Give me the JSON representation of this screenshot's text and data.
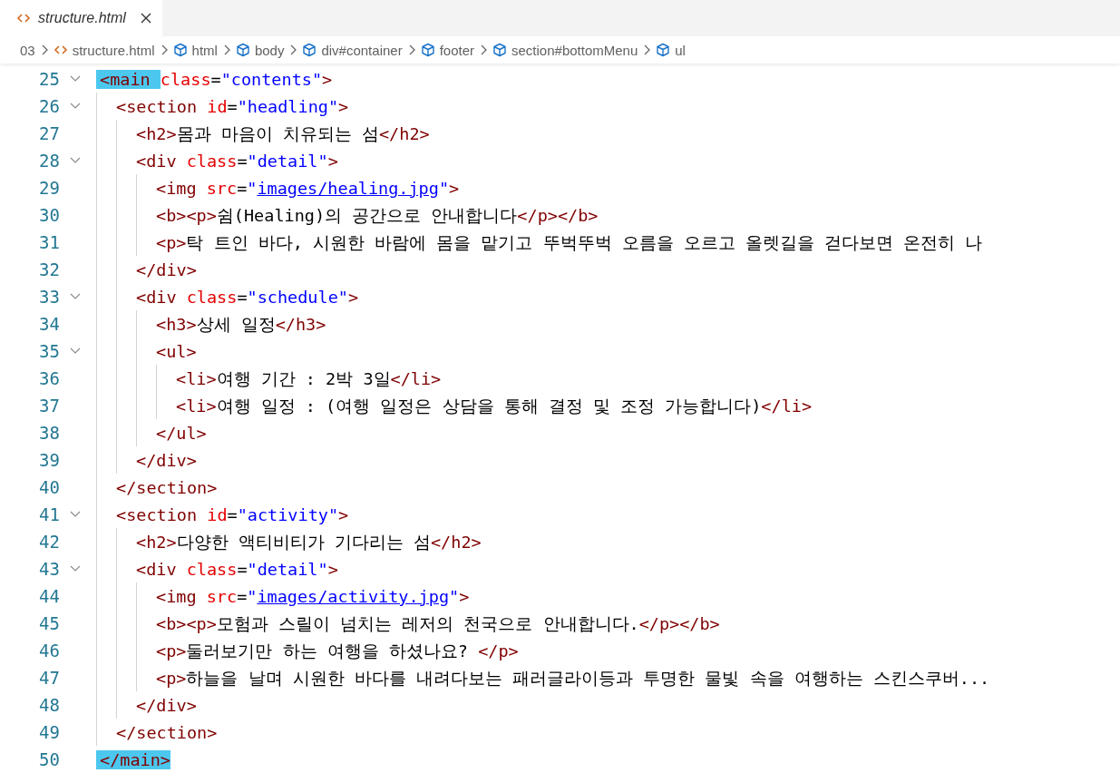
{
  "tab": {
    "title": "structure.html",
    "selected": true
  },
  "breadcrumb": [
    {
      "label": "03",
      "kind": "folder"
    },
    {
      "label": "structure.html",
      "kind": "file"
    },
    {
      "label": "html",
      "kind": "element"
    },
    {
      "label": "body",
      "kind": "element"
    },
    {
      "label": "div#container",
      "kind": "element"
    },
    {
      "label": "footer",
      "kind": "element"
    },
    {
      "label": "section#bottomMenu",
      "kind": "element"
    },
    {
      "label": "ul",
      "kind": "element"
    }
  ],
  "lines": [
    {
      "number": "25",
      "expanded": true,
      "tokens": [
        {
          "kind": "tag-hl",
          "text": "<main "
        },
        {
          "kind": "attr",
          "text": "class"
        },
        {
          "kind": "eq",
          "text": "="
        },
        {
          "kind": "string",
          "text": "\"contents\""
        },
        {
          "kind": "tag",
          "text": ">"
        }
      ],
      "children": [
        {
          "number": "26",
          "expanded": true,
          "tokens": [
            {
              "kind": "tag",
              "text": "<section "
            },
            {
              "kind": "attr",
              "text": "id"
            },
            {
              "kind": "eq",
              "text": "="
            },
            {
              "kind": "string",
              "text": "\"headling\""
            },
            {
              "kind": "tag",
              "text": ">"
            }
          ],
          "children": [
            {
              "number": "27",
              "tokens": [
                {
                  "kind": "tag",
                  "text": "<h2>"
                },
                {
                  "kind": "text",
                  "text": "몸과 마음이 치유되는 섬"
                },
                {
                  "kind": "tag",
                  "text": "</h2>"
                }
              ]
            },
            {
              "number": "28",
              "expanded": true,
              "tokens": [
                {
                  "kind": "tag",
                  "text": "<div "
                },
                {
                  "kind": "attr",
                  "text": "class"
                },
                {
                  "kind": "eq",
                  "text": "="
                },
                {
                  "kind": "string",
                  "text": "\"detail\""
                },
                {
                  "kind": "tag",
                  "text": ">"
                }
              ],
              "children": [
                {
                  "number": "29",
                  "tokens": [
                    {
                      "kind": "tag",
                      "text": "<img "
                    },
                    {
                      "kind": "attr",
                      "text": "src"
                    },
                    {
                      "kind": "eq",
                      "text": "="
                    },
                    {
                      "kind": "string",
                      "text": "\""
                    },
                    {
                      "kind": "link",
                      "text": "images/healing.jpg"
                    },
                    {
                      "kind": "string",
                      "text": "\""
                    },
                    {
                      "kind": "tag",
                      "text": ">"
                    }
                  ]
                },
                {
                  "number": "30",
                  "tokens": [
                    {
                      "kind": "tag",
                      "text": "<b><p>"
                    },
                    {
                      "kind": "text",
                      "text": "쉼(Healing)의 공간으로 안내합니다"
                    },
                    {
                      "kind": "tag",
                      "text": "</p></b>"
                    }
                  ]
                },
                {
                  "number": "31",
                  "tokens": [
                    {
                      "kind": "tag",
                      "text": "<p>"
                    },
                    {
                      "kind": "text",
                      "text": "탁 트인 바다, 시원한 바람에 몸을 맡기고 뚜벅뚜벅 오름을 오르고 올렛길을 걷다보면 온전히 나"
                    }
                  ]
                }
              ]
            },
            {
              "number": "32",
              "tokens": [
                {
                  "kind": "tag",
                  "text": "</div>"
                }
              ]
            },
            {
              "number": "33",
              "expanded": true,
              "tokens": [
                {
                  "kind": "tag",
                  "text": "<div "
                },
                {
                  "kind": "attr",
                  "text": "class"
                },
                {
                  "kind": "eq",
                  "text": "="
                },
                {
                  "kind": "string",
                  "text": "\"schedule\""
                },
                {
                  "kind": "tag",
                  "text": ">"
                }
              ],
              "children": [
                {
                  "number": "34",
                  "tokens": [
                    {
                      "kind": "tag",
                      "text": "<h3>"
                    },
                    {
                      "kind": "text",
                      "text": "상세 일정"
                    },
                    {
                      "kind": "tag",
                      "text": "</h3>"
                    }
                  ]
                },
                {
                  "number": "35",
                  "expanded": true,
                  "tokens": [
                    {
                      "kind": "tag",
                      "text": "<ul>"
                    }
                  ],
                  "children": [
                    {
                      "number": "36",
                      "tokens": [
                        {
                          "kind": "tag",
                          "text": "<li>"
                        },
                        {
                          "kind": "text",
                          "text": "여행 기간 : 2박 3일"
                        },
                        {
                          "kind": "tag",
                          "text": "</li>"
                        }
                      ]
                    },
                    {
                      "number": "37",
                      "tokens": [
                        {
                          "kind": "tag",
                          "text": "<li>"
                        },
                        {
                          "kind": "text",
                          "text": "여행 일정 : (여행 일정은 상담을 통해 결정 및 조정 가능합니다)"
                        },
                        {
                          "kind": "tag",
                          "text": "</li>"
                        }
                      ]
                    }
                  ]
                },
                {
                  "number": "38",
                  "tokens": [
                    {
                      "kind": "tag",
                      "text": "</ul>"
                    }
                  ]
                }
              ]
            },
            {
              "number": "39",
              "tokens": [
                {
                  "kind": "tag",
                  "text": "</div>"
                }
              ]
            }
          ]
        },
        {
          "number": "40",
          "tokens": [
            {
              "kind": "tag",
              "text": "</section>"
            }
          ]
        },
        {
          "number": "41",
          "expanded": true,
          "tokens": [
            {
              "kind": "tag",
              "text": "<section "
            },
            {
              "kind": "attr",
              "text": "id"
            },
            {
              "kind": "eq",
              "text": "="
            },
            {
              "kind": "string",
              "text": "\"activity\""
            },
            {
              "kind": "tag",
              "text": ">"
            }
          ],
          "children": [
            {
              "number": "42",
              "tokens": [
                {
                  "kind": "tag",
                  "text": "<h2>"
                },
                {
                  "kind": "text",
                  "text": "다양한 액티비티가 기다리는 섬"
                },
                {
                  "kind": "tag",
                  "text": "</h2>"
                }
              ]
            },
            {
              "number": "43",
              "expanded": true,
              "tokens": [
                {
                  "kind": "tag",
                  "text": "<div "
                },
                {
                  "kind": "attr",
                  "text": "class"
                },
                {
                  "kind": "eq",
                  "text": "="
                },
                {
                  "kind": "string",
                  "text": "\"detail\""
                },
                {
                  "kind": "tag",
                  "text": ">"
                }
              ],
              "children": [
                {
                  "number": "44",
                  "tokens": [
                    {
                      "kind": "tag",
                      "text": "<img "
                    },
                    {
                      "kind": "attr",
                      "text": "src"
                    },
                    {
                      "kind": "eq",
                      "text": "="
                    },
                    {
                      "kind": "string",
                      "text": "\""
                    },
                    {
                      "kind": "link",
                      "text": "images/activity.jpg"
                    },
                    {
                      "kind": "string",
                      "text": "\""
                    },
                    {
                      "kind": "tag",
                      "text": ">"
                    }
                  ]
                },
                {
                  "number": "45",
                  "tokens": [
                    {
                      "kind": "tag",
                      "text": "<b><p>"
                    },
                    {
                      "kind": "text",
                      "text": "모험과 스릴이 넘치는 레저의 천국으로 안내합니다."
                    },
                    {
                      "kind": "tag",
                      "text": "</p></b>"
                    }
                  ]
                },
                {
                  "number": "46",
                  "tokens": [
                    {
                      "kind": "tag",
                      "text": "<p>"
                    },
                    {
                      "kind": "text",
                      "text": "둘러보기만 하는 여행을 하셨나요? "
                    },
                    {
                      "kind": "tag",
                      "text": "</p>"
                    }
                  ]
                },
                {
                  "number": "47",
                  "tokens": [
                    {
                      "kind": "tag",
                      "text": "<p>"
                    },
                    {
                      "kind": "text",
                      "text": "하늘을 날며 시원한 바다를 내려다보는 패러글라이등과 투명한 물빛 속을 여행하는 스킨스쿠버..."
                    }
                  ]
                }
              ]
            },
            {
              "number": "48",
              "tokens": [
                {
                  "kind": "tag",
                  "text": "</div>"
                }
              ]
            }
          ]
        },
        {
          "number": "49",
          "tokens": [
            {
              "kind": "tag",
              "text": "</section>"
            }
          ]
        }
      ]
    },
    {
      "number": "50",
      "tokens": [
        {
          "kind": "tag-hl",
          "text": "</main>"
        }
      ]
    }
  ]
}
